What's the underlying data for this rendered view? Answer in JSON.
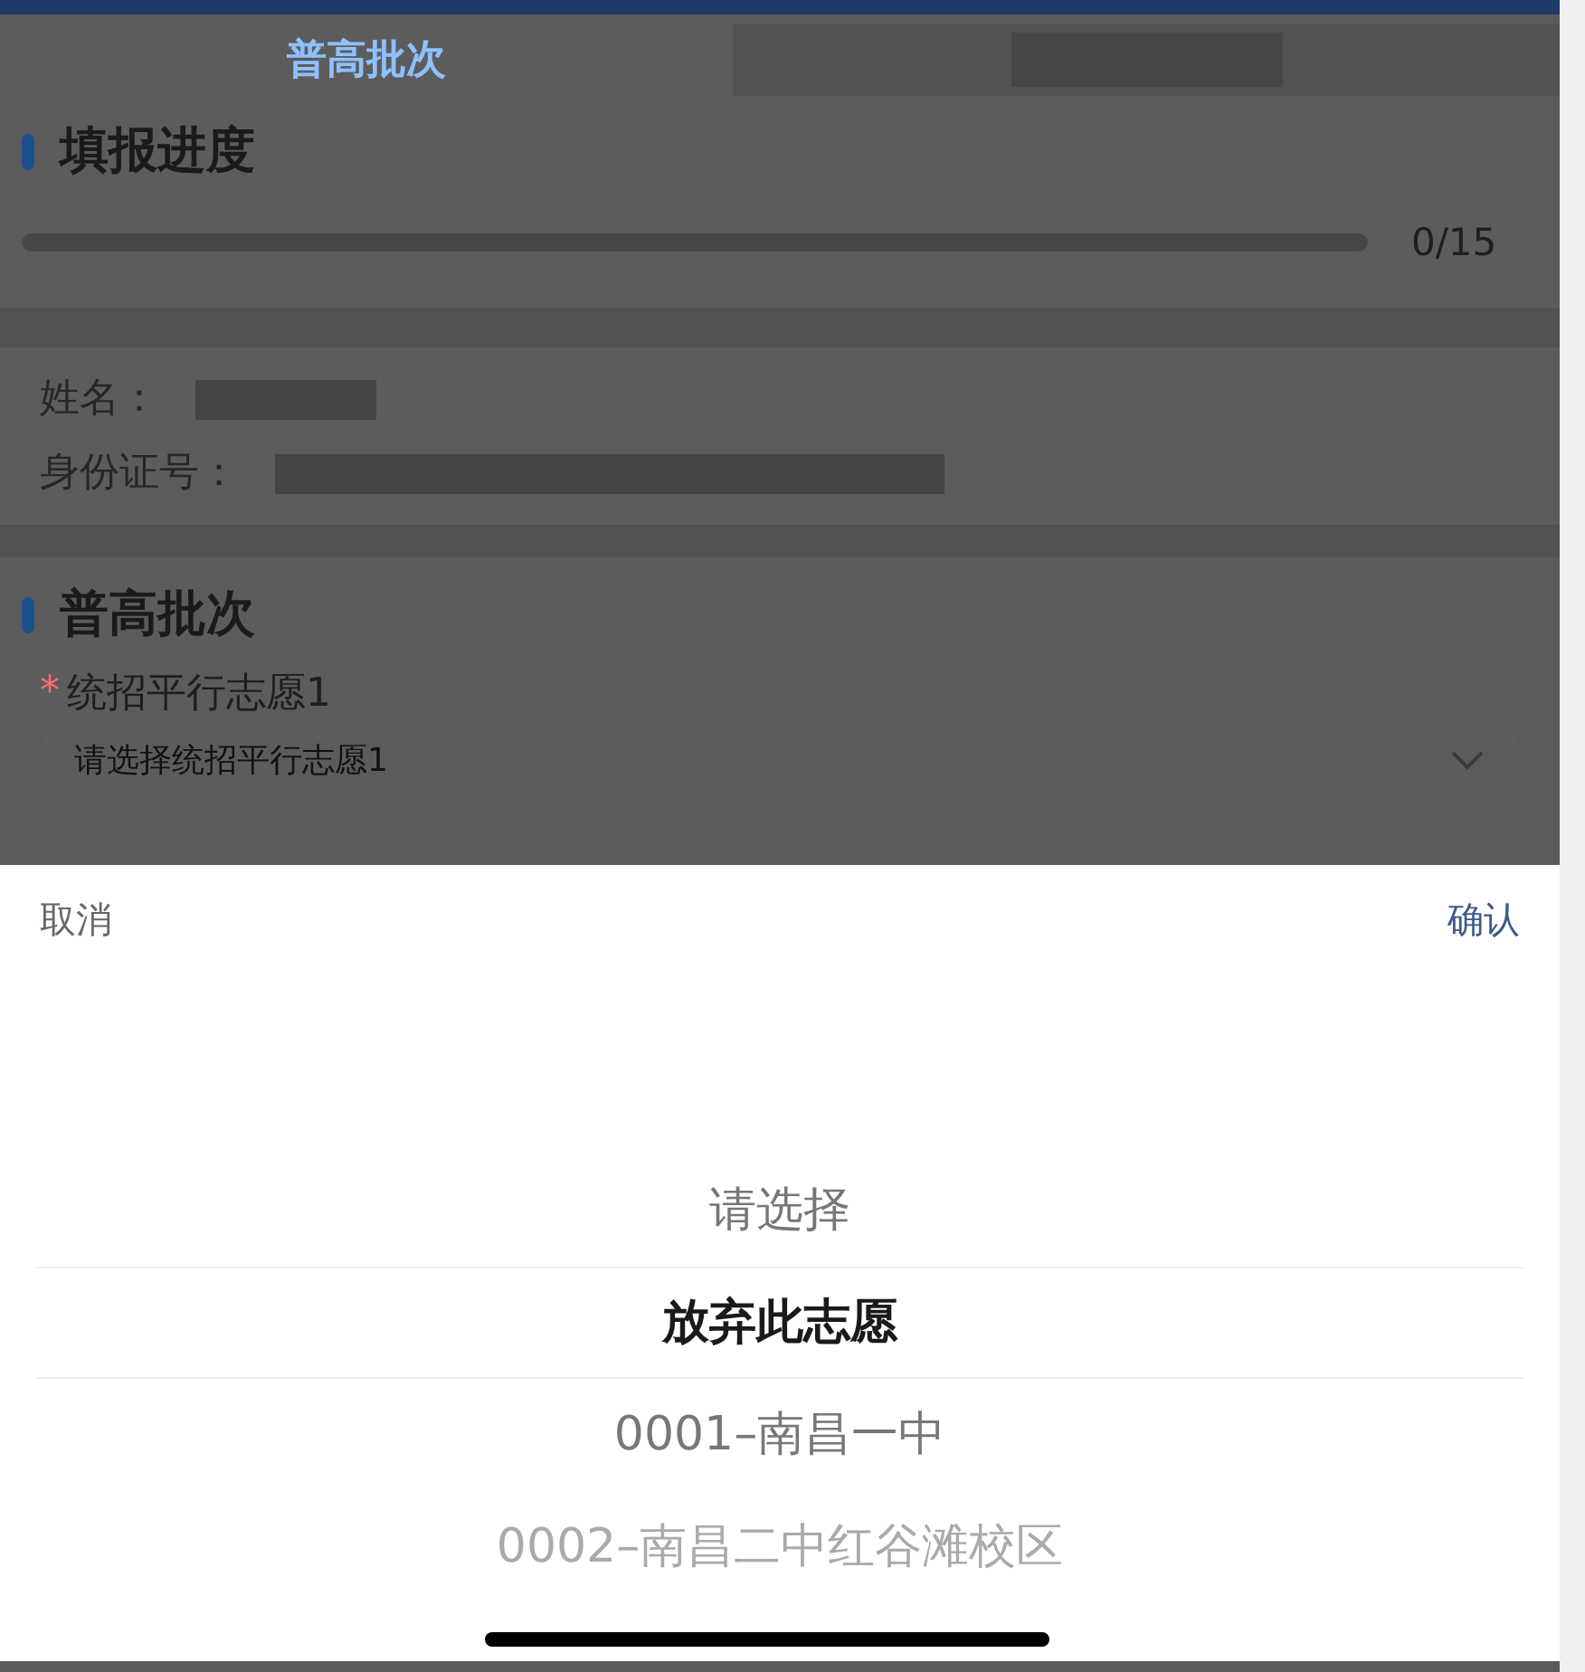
{
  "tabs": [
    {
      "label": "普高批次",
      "selected": true
    }
  ],
  "progress": {
    "title": "填报进度",
    "level": 0,
    "reading": "0/15"
  },
  "student": {
    "name_label": "姓名：",
    "id_label": "身份证号："
  },
  "batch": {
    "title": "普高批次",
    "field_label": "统招平行志愿1",
    "required_mark": "*",
    "placeholder": "请选择统招平行志愿1"
  },
  "picker": {
    "cancel": "取消",
    "confirm": "确认",
    "options": [
      {
        "label": "请选择",
        "selected": false
      },
      {
        "label": "放弃此志愿",
        "selected": true
      },
      {
        "label": "0001–南昌一中",
        "selected": false
      },
      {
        "label": "0002–南昌二中红谷滩校区",
        "selected": false
      }
    ]
  }
}
